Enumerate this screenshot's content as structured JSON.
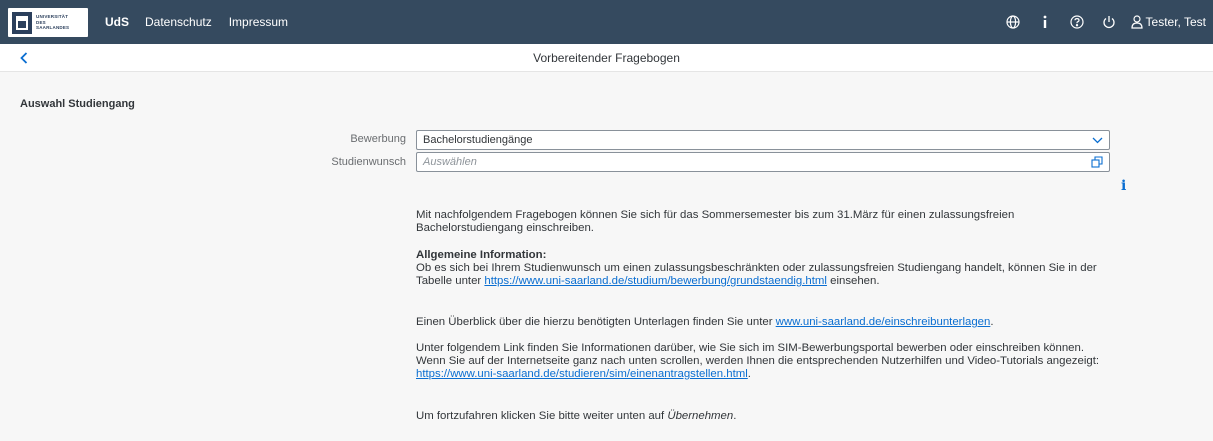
{
  "header": {
    "logo_lines": [
      "UNIVERSITÄT",
      "DES",
      "SAARLANDES"
    ],
    "nav": [
      {
        "label": "UdS"
      },
      {
        "label": "Datenschutz"
      },
      {
        "label": "Impressum"
      }
    ],
    "icons": [
      "globe-icon",
      "info-icon",
      "help-icon",
      "power-icon"
    ],
    "user_name": "Tester, Test",
    "background_color": "#354a5f"
  },
  "subheader": {
    "title": "Vorbereitender Fragebogen"
  },
  "form": {
    "section_title": "Auswahl Studiengang",
    "bewerbung_label": "Bewerbung",
    "bewerbung_value": "Bachelorstudiengänge",
    "studienwunsch_label": "Studienwunsch",
    "studienwunsch_placeholder": "Auswählen"
  },
  "content": {
    "intro": "Mit nachfolgendem Fragebogen können Sie sich für das Sommersemester bis zum 31.März für einen zulassungsfreien Bachelorstudiengang einschreiben.",
    "general_heading": "Allgemeine Information:",
    "general_text_pre": "Ob es sich bei Ihrem Studienwunsch um einen zulassungsbeschränkten oder zulassungsfreien Studiengang handelt, können Sie in der Tabelle unter ",
    "general_link": "https://www.uni-saarland.de/studium/bewerbung/grundstaendig.html",
    "general_text_post": " einsehen.",
    "overview_pre": "Einen Überblick über die hierzu benötigten Unterlagen finden Sie unter ",
    "overview_link": "www.uni-saarland.de/einschreibunterlagen",
    "overview_post": ".",
    "sim_pre": "Unter folgendem Link finden Sie Informationen darüber, wie Sie sich im SIM-Bewerbungsportal bewerben oder einschreiben können. Wenn Sie auf der Internetseite ganz nach unten scrollen, werden Ihnen die entsprechenden Nutzerhilfen und Video-Tutorials angezeigt: ",
    "sim_link": "https://www.uni-saarland.de/studieren/sim/einenantragstellen.html",
    "sim_post": ".",
    "continue_pre": "Um fortzufahren klicken Sie bitte weiter unten auf ",
    "continue_em": "Übernehmen",
    "continue_post": ".",
    "link_color": "#0a6ed1"
  }
}
